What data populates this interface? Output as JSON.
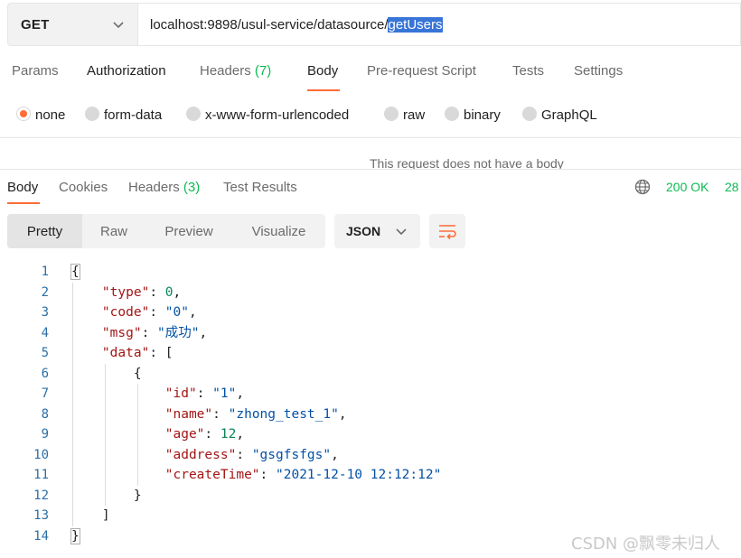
{
  "request": {
    "method": "GET",
    "url_base": "localhost:9898/usul-service/datasource/",
    "url_selected": "getUsers"
  },
  "request_tabs": [
    {
      "label": "Params"
    },
    {
      "label": "Authorization"
    },
    {
      "label": "Headers",
      "count": "(7)"
    },
    {
      "label": "Body"
    },
    {
      "label": "Pre-request Script"
    },
    {
      "label": "Tests"
    },
    {
      "label": "Settings"
    }
  ],
  "active_request_tab": "Body",
  "body_types": [
    "none",
    "form-data",
    "x-www-form-urlencoded",
    "raw",
    "binary",
    "GraphQL"
  ],
  "selected_body_type": "none",
  "no_body_message": "This request does not have a body",
  "response_tabs": [
    {
      "label": "Body"
    },
    {
      "label": "Cookies"
    },
    {
      "label": "Headers",
      "count": "(3)"
    },
    {
      "label": "Test Results"
    }
  ],
  "active_response_tab": "Body",
  "status": "200 OK",
  "time_partial": "28",
  "view_modes": [
    "Pretty",
    "Raw",
    "Preview",
    "Visualize"
  ],
  "active_view_mode": "Pretty",
  "format": "JSON",
  "code_lines": [
    {
      "num": "1",
      "text": "{"
    },
    {
      "num": "2",
      "text": "    \"type\": 0,"
    },
    {
      "num": "3",
      "text": "    \"code\": \"0\","
    },
    {
      "num": "4",
      "text": "    \"msg\": \"成功\","
    },
    {
      "num": "5",
      "text": "    \"data\": ["
    },
    {
      "num": "6",
      "text": "        {"
    },
    {
      "num": "7",
      "text": "            \"id\": \"1\","
    },
    {
      "num": "8",
      "text": "            \"name\": \"zhong_test_1\","
    },
    {
      "num": "9",
      "text": "            \"age\": 12,"
    },
    {
      "num": "10",
      "text": "            \"address\": \"gsgfsfgs\","
    },
    {
      "num": "11",
      "text": "            \"createTime\": \"2021-12-10 12:12:12\""
    },
    {
      "num": "12",
      "text": "        }"
    },
    {
      "num": "13",
      "text": "    ]"
    },
    {
      "num": "14",
      "text": "}"
    }
  ],
  "watermark": "CSDN @飘零未归人",
  "colors": {
    "accent": "#ff6c37",
    "status_green": "#0cbb52",
    "selection": "#3875d7",
    "json_key": "#a31515",
    "json_string": "#0451a5",
    "json_number": "#098658"
  },
  "icons": {
    "method_dropdown": "chevron-down-icon",
    "format_dropdown": "chevron-down-icon",
    "wrap": "wrap-lines-icon",
    "network": "globe-icon"
  }
}
